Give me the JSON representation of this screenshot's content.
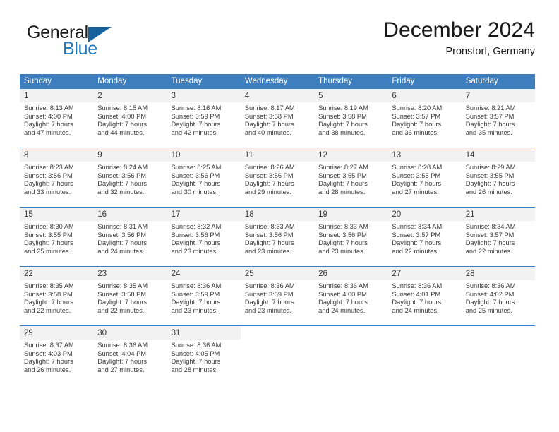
{
  "brand": {
    "word1": "General",
    "word2": "Blue",
    "triangle_color": "#14619e",
    "blue_color": "#1f7ac0"
  },
  "header": {
    "title": "December 2024",
    "subtitle": "Pronstorf, Germany"
  },
  "theme": {
    "header_blue": "#3d7ebe",
    "daynum_bg": "#f2f2f2"
  },
  "weekday_headers": [
    "Sunday",
    "Monday",
    "Tuesday",
    "Wednesday",
    "Thursday",
    "Friday",
    "Saturday"
  ],
  "weeks": [
    [
      {
        "day": "1",
        "sunrise": "Sunrise: 8:13 AM",
        "sunset": "Sunset: 4:00 PM",
        "daylight1": "Daylight: 7 hours",
        "daylight2": "and 47 minutes."
      },
      {
        "day": "2",
        "sunrise": "Sunrise: 8:15 AM",
        "sunset": "Sunset: 4:00 PM",
        "daylight1": "Daylight: 7 hours",
        "daylight2": "and 44 minutes."
      },
      {
        "day": "3",
        "sunrise": "Sunrise: 8:16 AM",
        "sunset": "Sunset: 3:59 PM",
        "daylight1": "Daylight: 7 hours",
        "daylight2": "and 42 minutes."
      },
      {
        "day": "4",
        "sunrise": "Sunrise: 8:17 AM",
        "sunset": "Sunset: 3:58 PM",
        "daylight1": "Daylight: 7 hours",
        "daylight2": "and 40 minutes."
      },
      {
        "day": "5",
        "sunrise": "Sunrise: 8:19 AM",
        "sunset": "Sunset: 3:58 PM",
        "daylight1": "Daylight: 7 hours",
        "daylight2": "and 38 minutes."
      },
      {
        "day": "6",
        "sunrise": "Sunrise: 8:20 AM",
        "sunset": "Sunset: 3:57 PM",
        "daylight1": "Daylight: 7 hours",
        "daylight2": "and 36 minutes."
      },
      {
        "day": "7",
        "sunrise": "Sunrise: 8:21 AM",
        "sunset": "Sunset: 3:57 PM",
        "daylight1": "Daylight: 7 hours",
        "daylight2": "and 35 minutes."
      }
    ],
    [
      {
        "day": "8",
        "sunrise": "Sunrise: 8:23 AM",
        "sunset": "Sunset: 3:56 PM",
        "daylight1": "Daylight: 7 hours",
        "daylight2": "and 33 minutes."
      },
      {
        "day": "9",
        "sunrise": "Sunrise: 8:24 AM",
        "sunset": "Sunset: 3:56 PM",
        "daylight1": "Daylight: 7 hours",
        "daylight2": "and 32 minutes."
      },
      {
        "day": "10",
        "sunrise": "Sunrise: 8:25 AM",
        "sunset": "Sunset: 3:56 PM",
        "daylight1": "Daylight: 7 hours",
        "daylight2": "and 30 minutes."
      },
      {
        "day": "11",
        "sunrise": "Sunrise: 8:26 AM",
        "sunset": "Sunset: 3:56 PM",
        "daylight1": "Daylight: 7 hours",
        "daylight2": "and 29 minutes."
      },
      {
        "day": "12",
        "sunrise": "Sunrise: 8:27 AM",
        "sunset": "Sunset: 3:55 PM",
        "daylight1": "Daylight: 7 hours",
        "daylight2": "and 28 minutes."
      },
      {
        "day": "13",
        "sunrise": "Sunrise: 8:28 AM",
        "sunset": "Sunset: 3:55 PM",
        "daylight1": "Daylight: 7 hours",
        "daylight2": "and 27 minutes."
      },
      {
        "day": "14",
        "sunrise": "Sunrise: 8:29 AM",
        "sunset": "Sunset: 3:55 PM",
        "daylight1": "Daylight: 7 hours",
        "daylight2": "and 26 minutes."
      }
    ],
    [
      {
        "day": "15",
        "sunrise": "Sunrise: 8:30 AM",
        "sunset": "Sunset: 3:55 PM",
        "daylight1": "Daylight: 7 hours",
        "daylight2": "and 25 minutes."
      },
      {
        "day": "16",
        "sunrise": "Sunrise: 8:31 AM",
        "sunset": "Sunset: 3:56 PM",
        "daylight1": "Daylight: 7 hours",
        "daylight2": "and 24 minutes."
      },
      {
        "day": "17",
        "sunrise": "Sunrise: 8:32 AM",
        "sunset": "Sunset: 3:56 PM",
        "daylight1": "Daylight: 7 hours",
        "daylight2": "and 23 minutes."
      },
      {
        "day": "18",
        "sunrise": "Sunrise: 8:33 AM",
        "sunset": "Sunset: 3:56 PM",
        "daylight1": "Daylight: 7 hours",
        "daylight2": "and 23 minutes."
      },
      {
        "day": "19",
        "sunrise": "Sunrise: 8:33 AM",
        "sunset": "Sunset: 3:56 PM",
        "daylight1": "Daylight: 7 hours",
        "daylight2": "and 23 minutes."
      },
      {
        "day": "20",
        "sunrise": "Sunrise: 8:34 AM",
        "sunset": "Sunset: 3:57 PM",
        "daylight1": "Daylight: 7 hours",
        "daylight2": "and 22 minutes."
      },
      {
        "day": "21",
        "sunrise": "Sunrise: 8:34 AM",
        "sunset": "Sunset: 3:57 PM",
        "daylight1": "Daylight: 7 hours",
        "daylight2": "and 22 minutes."
      }
    ],
    [
      {
        "day": "22",
        "sunrise": "Sunrise: 8:35 AM",
        "sunset": "Sunset: 3:58 PM",
        "daylight1": "Daylight: 7 hours",
        "daylight2": "and 22 minutes."
      },
      {
        "day": "23",
        "sunrise": "Sunrise: 8:35 AM",
        "sunset": "Sunset: 3:58 PM",
        "daylight1": "Daylight: 7 hours",
        "daylight2": "and 22 minutes."
      },
      {
        "day": "24",
        "sunrise": "Sunrise: 8:36 AM",
        "sunset": "Sunset: 3:59 PM",
        "daylight1": "Daylight: 7 hours",
        "daylight2": "and 23 minutes."
      },
      {
        "day": "25",
        "sunrise": "Sunrise: 8:36 AM",
        "sunset": "Sunset: 3:59 PM",
        "daylight1": "Daylight: 7 hours",
        "daylight2": "and 23 minutes."
      },
      {
        "day": "26",
        "sunrise": "Sunrise: 8:36 AM",
        "sunset": "Sunset: 4:00 PM",
        "daylight1": "Daylight: 7 hours",
        "daylight2": "and 24 minutes."
      },
      {
        "day": "27",
        "sunrise": "Sunrise: 8:36 AM",
        "sunset": "Sunset: 4:01 PM",
        "daylight1": "Daylight: 7 hours",
        "daylight2": "and 24 minutes."
      },
      {
        "day": "28",
        "sunrise": "Sunrise: 8:36 AM",
        "sunset": "Sunset: 4:02 PM",
        "daylight1": "Daylight: 7 hours",
        "daylight2": "and 25 minutes."
      }
    ],
    [
      {
        "day": "29",
        "sunrise": "Sunrise: 8:37 AM",
        "sunset": "Sunset: 4:03 PM",
        "daylight1": "Daylight: 7 hours",
        "daylight2": "and 26 minutes."
      },
      {
        "day": "30",
        "sunrise": "Sunrise: 8:36 AM",
        "sunset": "Sunset: 4:04 PM",
        "daylight1": "Daylight: 7 hours",
        "daylight2": "and 27 minutes."
      },
      {
        "day": "31",
        "sunrise": "Sunrise: 8:36 AM",
        "sunset": "Sunset: 4:05 PM",
        "daylight1": "Daylight: 7 hours",
        "daylight2": "and 28 minutes."
      },
      {
        "day": "",
        "sunrise": "",
        "sunset": "",
        "daylight1": "",
        "daylight2": ""
      },
      {
        "day": "",
        "sunrise": "",
        "sunset": "",
        "daylight1": "",
        "daylight2": ""
      },
      {
        "day": "",
        "sunrise": "",
        "sunset": "",
        "daylight1": "",
        "daylight2": ""
      },
      {
        "day": "",
        "sunrise": "",
        "sunset": "",
        "daylight1": "",
        "daylight2": ""
      }
    ]
  ]
}
